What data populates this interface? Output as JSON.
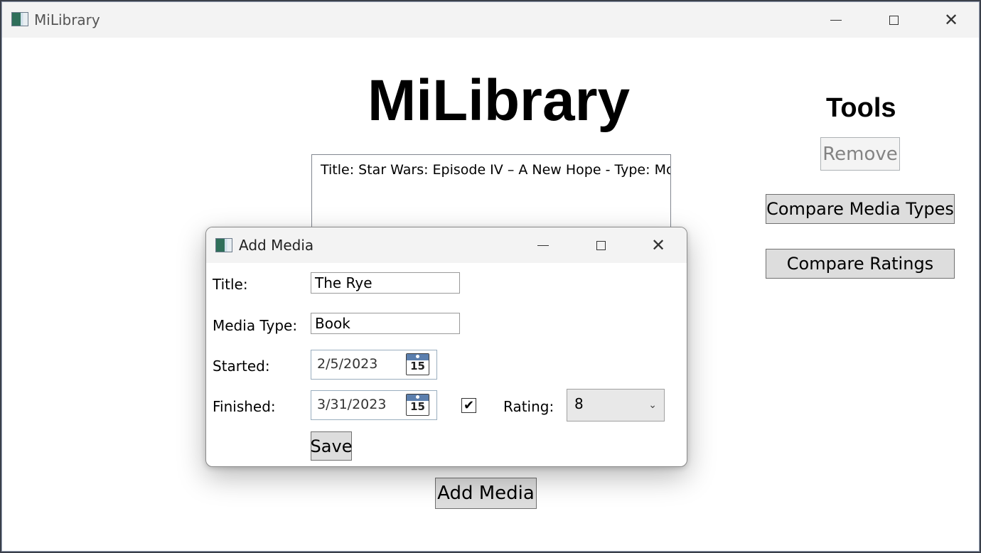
{
  "window": {
    "title": "MiLibrary",
    "controls": {
      "minimize": "—",
      "maximize": "□",
      "close": "✕"
    }
  },
  "main": {
    "heading": "MiLibrary",
    "media_list": [
      "Title: Star Wars: Episode IV – A New Hope - Type: Movie"
    ],
    "add_media_label": "Add Media"
  },
  "tools": {
    "heading": "Tools",
    "remove_label": "Remove",
    "compare_types_label": "Compare Media Types",
    "compare_ratings_label": "Compare Ratings"
  },
  "dialog": {
    "title": "Add Media",
    "fields": {
      "title_label": "Title:",
      "title_value": "The Rye",
      "media_type_label": "Media Type:",
      "media_type_value": "Book",
      "started_label": "Started:",
      "started_value": "2/5/2023",
      "finished_label": "Finished:",
      "finished_value": "3/31/2023",
      "finished_checked": "✔",
      "rating_label": "Rating:",
      "rating_value": "8",
      "calendar_day": "15"
    },
    "save_label": "Save"
  },
  "icons": [
    "app-icon",
    "minimize-icon",
    "maximize-icon",
    "close-icon",
    "calendar-icon",
    "checkmark-icon",
    "chevron-down-icon"
  ],
  "colors": {
    "calendar_header": "#5b7fae",
    "button_face": "#dddddd",
    "disabled_text": "#838383"
  }
}
